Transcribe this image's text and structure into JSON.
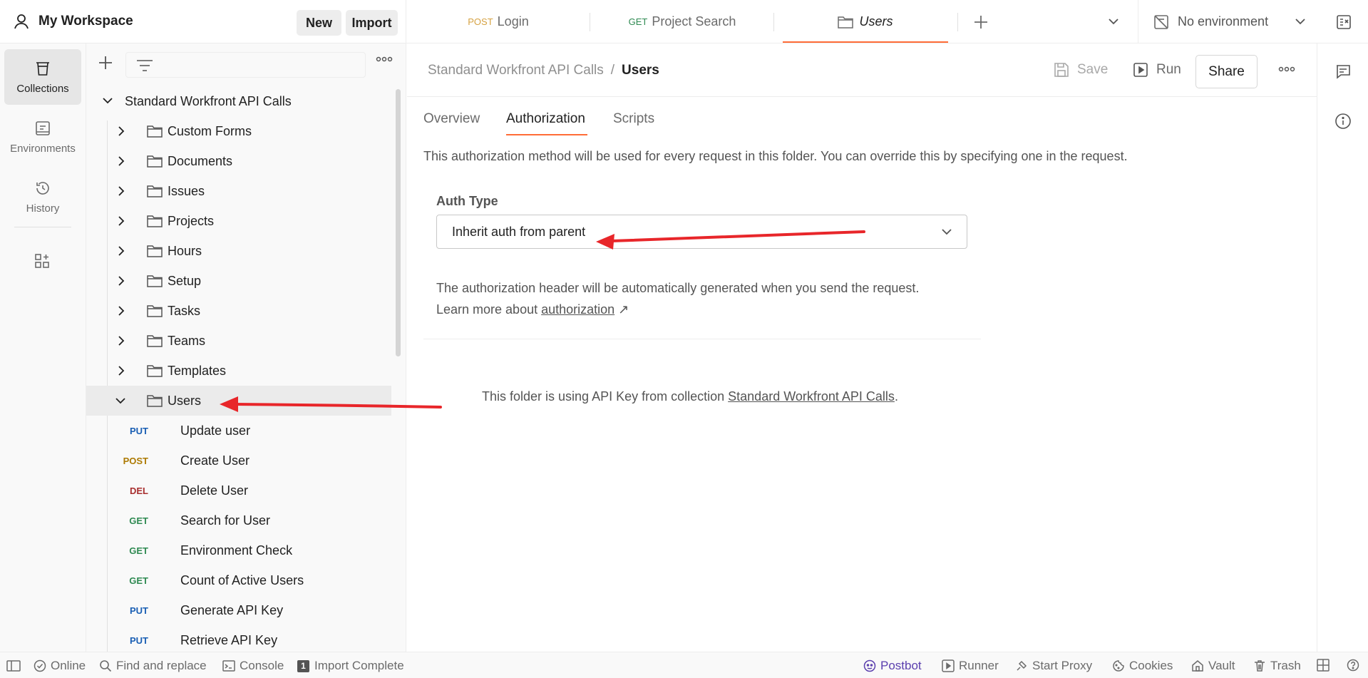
{
  "workspace": {
    "title": "My Workspace",
    "new_label": "New",
    "import_label": "Import"
  },
  "tabs": [
    {
      "method": "POST",
      "method_color": "#d6a243",
      "label": "Login"
    },
    {
      "method": "GET",
      "method_color": "#2f8a52",
      "label": "Project Search"
    },
    {
      "method": "",
      "label": "Users"
    }
  ],
  "environment": {
    "label": "No environment"
  },
  "leftnav": {
    "items": [
      {
        "label": "Collections",
        "icon": "trash-can-icon"
      },
      {
        "label": "Environments",
        "icon": "environment-icon"
      },
      {
        "label": "History",
        "icon": "history-icon"
      }
    ]
  },
  "sidebar": {
    "collection": "Standard Workfront API Calls",
    "folders": [
      "Custom Forms",
      "Documents",
      "Issues",
      "Projects",
      "Hours",
      "Setup",
      "Tasks",
      "Teams",
      "Templates",
      "Users"
    ],
    "requests": [
      {
        "method": "PUT",
        "label": "Update user"
      },
      {
        "method": "POST",
        "label": "Create User"
      },
      {
        "method": "DEL",
        "label": "Delete User"
      },
      {
        "method": "GET",
        "label": "Search for User"
      },
      {
        "method": "GET",
        "label": "Environment Check"
      },
      {
        "method": "GET",
        "label": "Count of Active Users"
      },
      {
        "method": "PUT",
        "label": "Generate API Key"
      },
      {
        "method": "PUT",
        "label": "Retrieve API Key"
      }
    ]
  },
  "colors": {
    "GET": "#2f8a52",
    "POST": "#ad7a03",
    "PUT": "#1a5fb4",
    "DEL": "#a82f2f",
    "accent": "#ff6c37",
    "arrow": "#e8262a"
  },
  "main": {
    "breadcrumb_parent": "Standard Workfront API Calls",
    "breadcrumb_sep": "/",
    "breadcrumb_current": "Users",
    "save_label": "Save",
    "run_label": "Run",
    "share_label": "Share",
    "subtabs": [
      "Overview",
      "Authorization",
      "Scripts"
    ],
    "description": "This authorization method will be used for every request in this folder. You can override this by specifying one in the request.",
    "auth_type_label": "Auth Type",
    "auth_type_value": "Inherit auth from parent",
    "auth_note_line1": "The authorization header will be automatically generated when you send the request.",
    "auth_note_prefix": "Learn more about ",
    "auth_note_link": "authorization",
    "auth_note_link_suffix": " ↗",
    "folder_note_prefix": "This folder is using API Key from collection ",
    "folder_note_link": "Standard Workfront API Calls",
    "folder_note_suffix": "."
  },
  "statusbar": {
    "online": "Online",
    "find_replace": "Find and replace",
    "console": "Console",
    "import_count": "1",
    "import_complete": "Import Complete",
    "postbot": "Postbot",
    "runner": "Runner",
    "start_proxy": "Start Proxy",
    "cookies": "Cookies",
    "vault": "Vault",
    "trash": "Trash"
  }
}
